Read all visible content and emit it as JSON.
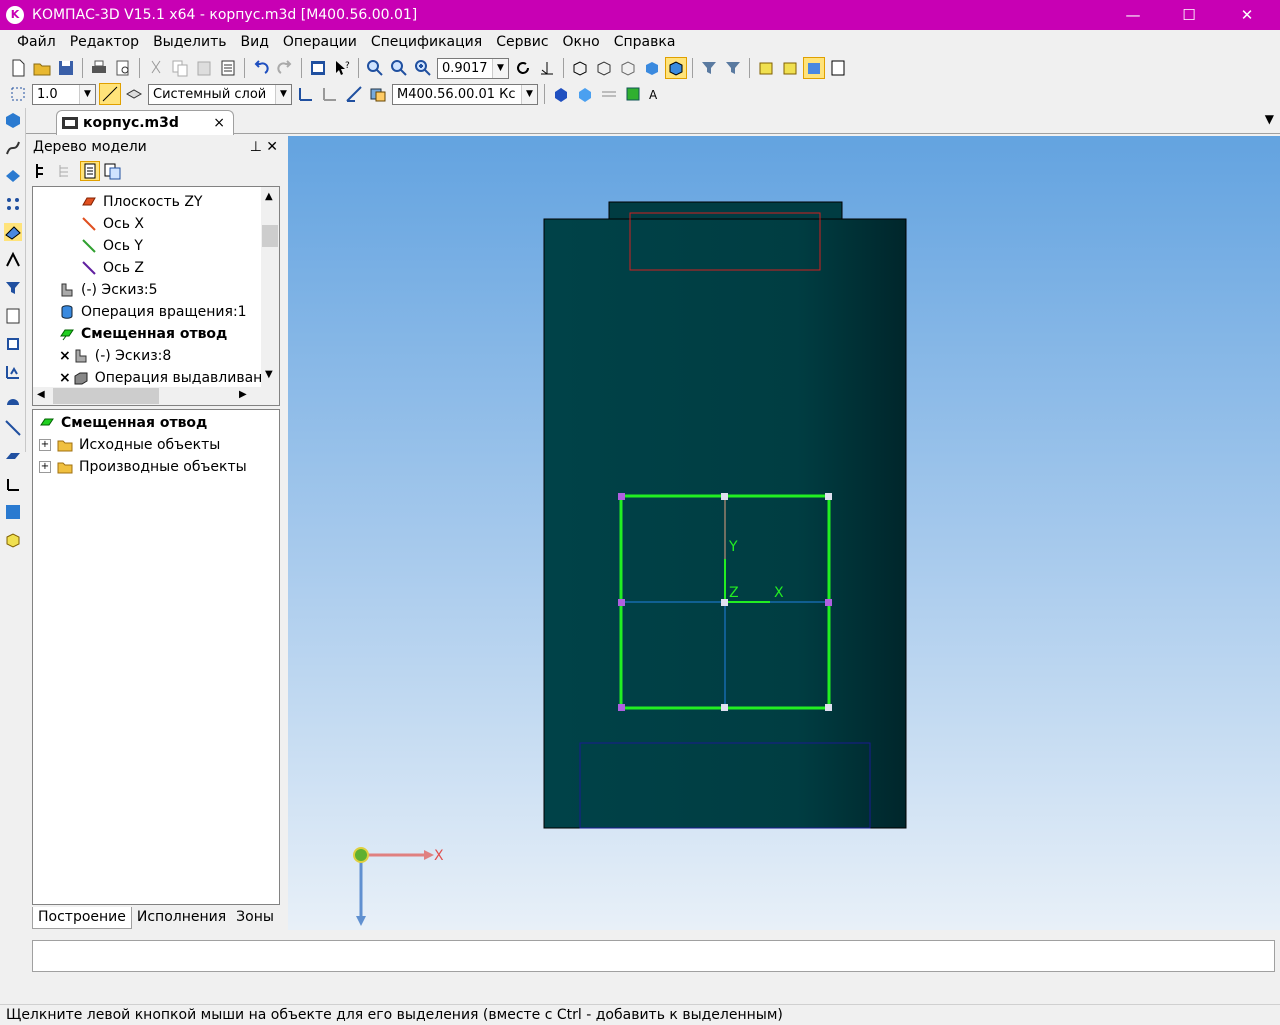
{
  "window": {
    "title": "КОМПАС-3D V15.1 x64 - корпус.m3d [M400.56.00.01]",
    "app_icon_letter": "K",
    "minimize": "—",
    "maximize": "☐",
    "close": "✕"
  },
  "menu": [
    "Файл",
    "Редактор",
    "Выделить",
    "Вид",
    "Операции",
    "Спецификация",
    "Сервис",
    "Окно",
    "Справка"
  ],
  "toolbar1": {
    "zoom_value": "0.9017"
  },
  "toolbar2": {
    "step_value": "1.0",
    "layer": "Системный слой",
    "designation": "М400.56.00.01 Кс"
  },
  "document_tab": {
    "label": "корпус.m3d",
    "close": "×"
  },
  "model_tree": {
    "title": "Дерево модели",
    "pin": "⊥",
    "close": "✕",
    "items": [
      {
        "label": "Плоскость ZY",
        "icon": "plane-icon"
      },
      {
        "label": "Ось X",
        "icon": "axis-x-icon"
      },
      {
        "label": "Ось Y",
        "icon": "axis-y-icon"
      },
      {
        "label": "Ось Z",
        "icon": "axis-z-icon"
      },
      {
        "label": "(-) Эскиз:5",
        "icon": "sketch-icon"
      },
      {
        "label": "Операция вращения:1",
        "icon": "revolve-icon"
      },
      {
        "label": "Смещенная отвод",
        "icon": "offset-plane-icon"
      },
      {
        "label": "(-) Эскиз:8",
        "icon": "sketch-icon"
      },
      {
        "label": "Операция выдавливания",
        "icon": "extrude-icon"
      }
    ],
    "detail": {
      "selected": "Смещенная отвод",
      "children": [
        "Исходные объекты",
        "Производные объекты"
      ]
    },
    "tabs": [
      "Построение",
      "Исполнения",
      "Зоны"
    ],
    "active_tab": "Построение"
  },
  "viewport": {
    "sketch_axis_labels": {
      "y": "Y",
      "z": "Z",
      "x": "X"
    },
    "triad_label": "X",
    "body_color": "#003f44",
    "sketch_color": "#22ee22"
  },
  "status": "Щелкните левой кнопкой мыши на объекте для его выделения (вместе с Ctrl - добавить к выделенным)"
}
